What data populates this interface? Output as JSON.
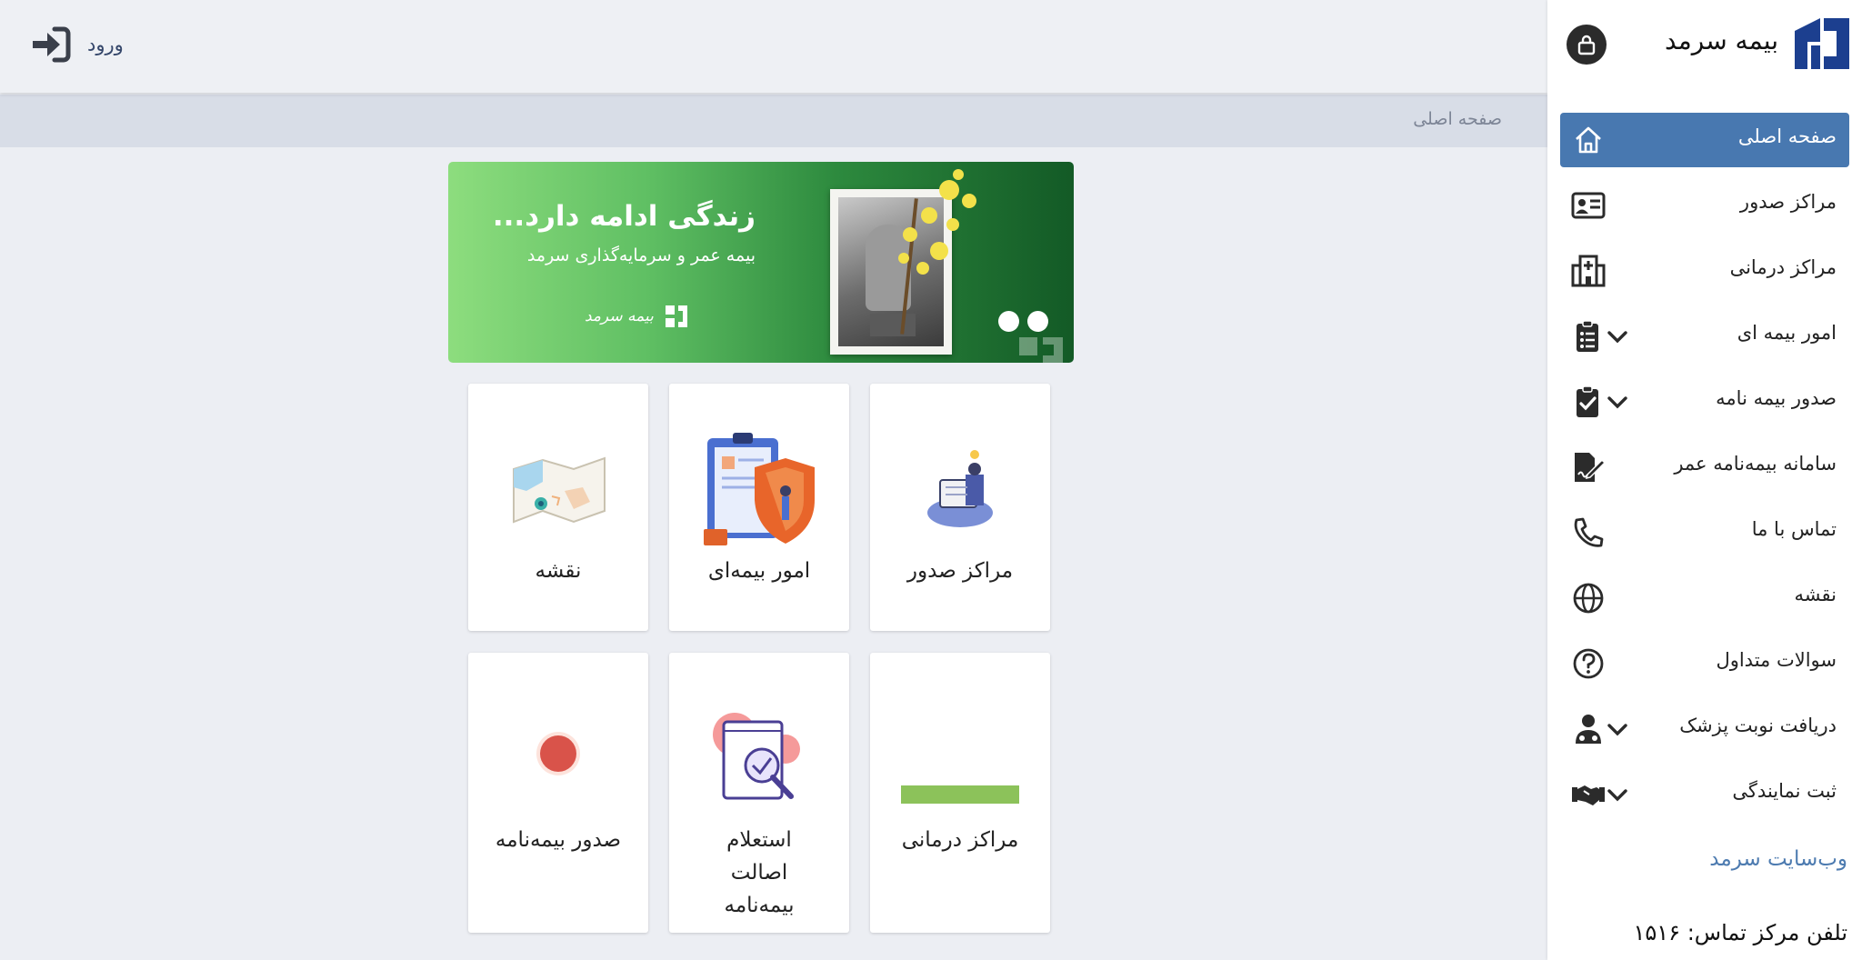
{
  "header": {
    "login_label": "ورود"
  },
  "breadcrumb": {
    "current": "صفحه اصلی"
  },
  "banner": {
    "title": "زندگی ادامه دارد...",
    "subtitle": "بیمه عمر و سرمایه‌گذاری سرمد",
    "logo_text": "بیمه سرمد"
  },
  "tiles": [
    {
      "label": "مراکز صدور",
      "icon": "issuing-center-illustration"
    },
    {
      "label": "امور بیمه‌ای",
      "icon": "insurance-shield-illustration"
    },
    {
      "label": "نقشه",
      "icon": "map-illustration"
    },
    {
      "label": "مراکز درمانی",
      "icon": "medical-center-image"
    },
    {
      "label": "استعلام اصالت بیمه‌نامه",
      "icon": "authenticity-inquiry-illustration"
    },
    {
      "label": "صدور بیمه‌نامه",
      "icon": "policy-issue-dot"
    }
  ],
  "sidebar": {
    "brand_name": "بیمه سرمد",
    "items": [
      {
        "label": "صفحه اصلی",
        "icon": "home-icon",
        "active": true
      },
      {
        "label": "مراکز صدور",
        "icon": "id-card-icon"
      },
      {
        "label": "مراکز درمانی",
        "icon": "hospital-icon"
      },
      {
        "label": "امور بیمه ای",
        "icon": "clipboard-list-icon",
        "expandable": true
      },
      {
        "label": "صدور بیمه نامه",
        "icon": "clipboard-check-icon",
        "expandable": true
      },
      {
        "label": "سامانه بیمه‌نامه عمر",
        "icon": "file-signature-icon"
      },
      {
        "label": "تماس با ما",
        "icon": "phone-icon"
      },
      {
        "label": "نقشه",
        "icon": "globe-icon"
      },
      {
        "label": "سوالات متداول",
        "icon": "question-icon"
      },
      {
        "label": "دریافت نوبت پزشک",
        "icon": "doctor-icon",
        "expandable": true
      },
      {
        "label": "ثبت نمایندگی",
        "icon": "handshake-icon",
        "expandable": true
      }
    ],
    "website_link": "وب‌سایت سرمد",
    "contact_phone": "تلفن مرکز تماس: ۱۵۱۶"
  },
  "colors": {
    "accent": "#4878b0",
    "brand": "#1c3f8f",
    "link": "#4d7bb0"
  }
}
